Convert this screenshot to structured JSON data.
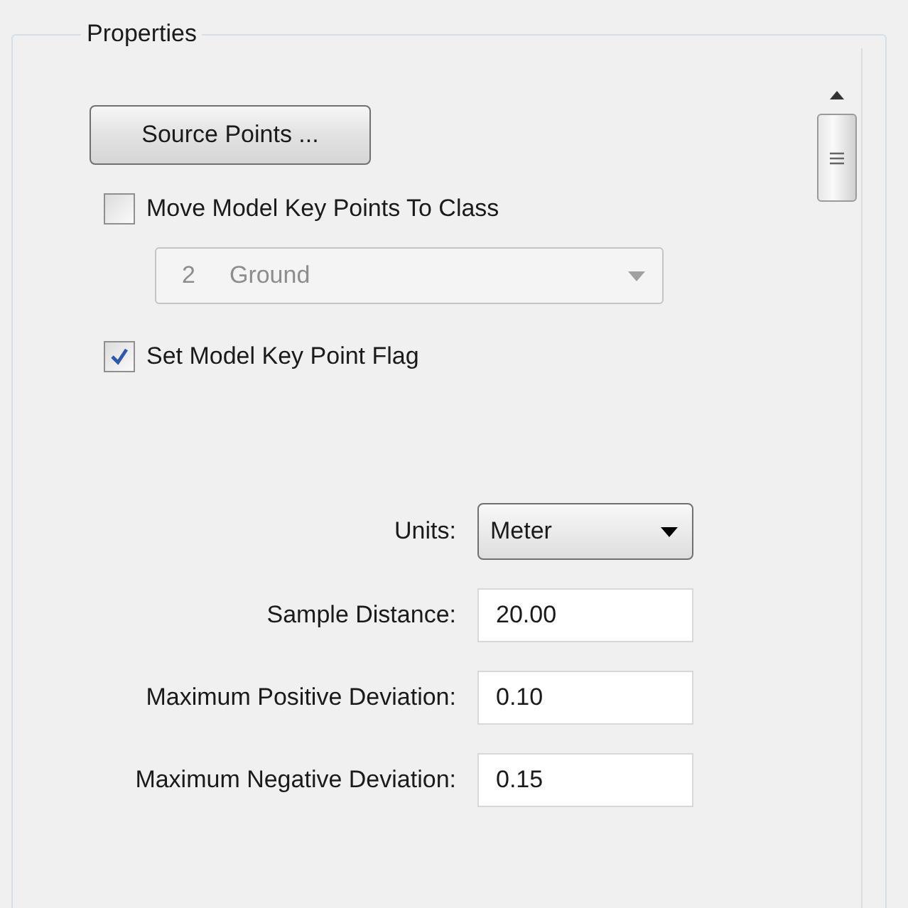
{
  "group": {
    "title": "Properties"
  },
  "source_button": {
    "label": "Source Points ..."
  },
  "move_option": {
    "label": "Move Model Key Points To Class",
    "checked": false
  },
  "class_select": {
    "code": "2",
    "name": "Ground",
    "disabled": true
  },
  "flag_option": {
    "label": "Set Model Key Point Flag",
    "checked": true
  },
  "fields": [
    {
      "kind": "select",
      "label": "Units:",
      "value": "Meter"
    },
    {
      "kind": "input",
      "label": "Sample Distance:",
      "value": "20.00"
    },
    {
      "kind": "input",
      "label": "Maximum Positive Deviation:",
      "value": "0.10"
    },
    {
      "kind": "input",
      "label": "Maximum Negative Deviation:",
      "value": "0.15"
    }
  ]
}
